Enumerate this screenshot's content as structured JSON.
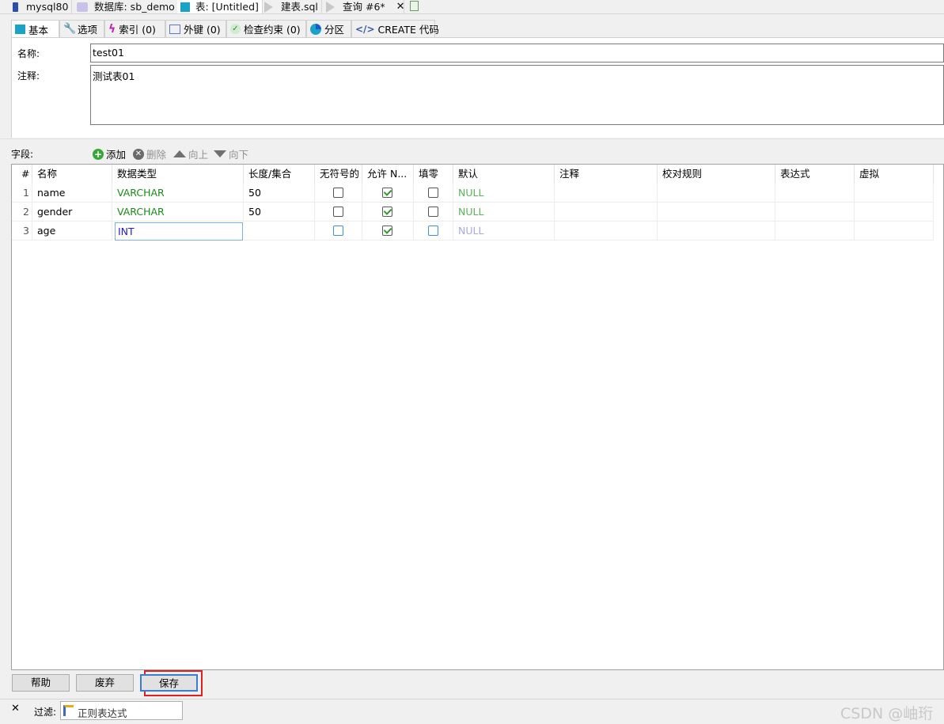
{
  "tabs": [
    {
      "label": "mysql80"
    },
    {
      "label": "数据库: sb_demo"
    },
    {
      "label": "表: [Untitled]"
    },
    {
      "label": "建表.sql"
    },
    {
      "label": "查询 #6*"
    }
  ],
  "subtabs": [
    {
      "label": "基本"
    },
    {
      "label": "选项"
    },
    {
      "label": "索引 (0)"
    },
    {
      "label": "外键 (0)"
    },
    {
      "label": "检查约束 (0)"
    },
    {
      "label": "分区"
    },
    {
      "label": "CREATE 代码"
    }
  ],
  "basic": {
    "name_label": "名称:",
    "name_value": "test01",
    "comment_label": "注释:",
    "comment_value": "测试表01"
  },
  "fields_toolbar": {
    "label": "字段:",
    "add": "添加",
    "delete": "删除",
    "up": "向上",
    "down": "向下"
  },
  "grid": {
    "columns": [
      "#",
      "名称",
      "数据类型",
      "长度/集合",
      "无符号的",
      "允许 N...",
      "填零",
      "默认",
      "注释",
      "校对规则",
      "表达式",
      "虚拟"
    ],
    "rows": [
      {
        "num": "1",
        "name": "name",
        "type": "VARCHAR",
        "length": "50",
        "unsigned": false,
        "allow_null": true,
        "zerofill": false,
        "default": "NULL"
      },
      {
        "num": "2",
        "name": "gender",
        "type": "VARCHAR",
        "length": "50",
        "unsigned": false,
        "allow_null": true,
        "zerofill": false,
        "default": "NULL"
      },
      {
        "num": "3",
        "name": "age",
        "type": "INT",
        "length": "",
        "unsigned": false,
        "allow_null": true,
        "zerofill": false,
        "default": "NULL"
      }
    ]
  },
  "buttons": {
    "help": "帮助",
    "discard": "废弃",
    "save": "保存"
  },
  "filter": {
    "close": "✕",
    "label": "过滤:",
    "placeholder": "正则表达式"
  },
  "watermark": "CSDN @岫珩"
}
